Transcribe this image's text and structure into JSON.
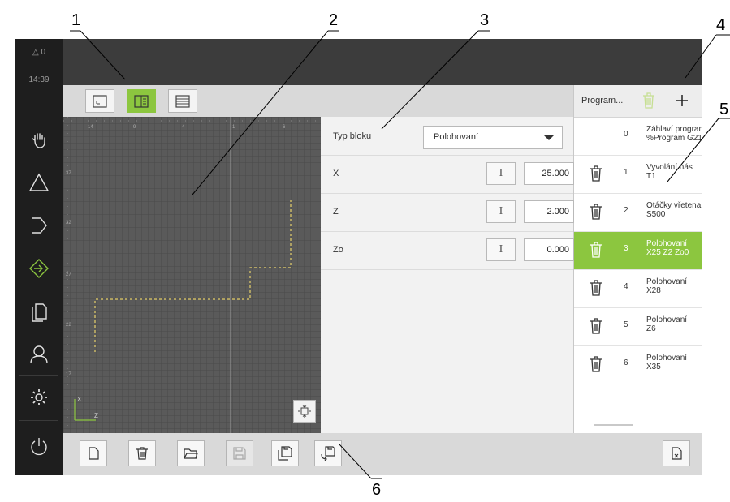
{
  "callouts": {
    "c1": "1",
    "c2": "2",
    "c3": "3",
    "c4": "4",
    "c5": "5",
    "c6": "6"
  },
  "status": {
    "alerts": "0",
    "time": "14:39"
  },
  "sidebar": {
    "items": [
      {
        "icon": "hand-icon"
      },
      {
        "icon": "triangle-icon"
      },
      {
        "icon": "arrow-right-icon"
      },
      {
        "icon": "program-run-icon"
      },
      {
        "icon": "documents-icon"
      },
      {
        "icon": "user-icon"
      },
      {
        "icon": "gear-icon"
      },
      {
        "icon": "power-icon"
      }
    ]
  },
  "toolbar": {
    "views": [
      "graphics-view",
      "split-view",
      "list-view"
    ],
    "active": "split-view"
  },
  "canvas": {
    "x_ticks": [
      "14",
      "9",
      "4",
      "1",
      "6"
    ],
    "y_ticks": [
      "37",
      "32",
      "27",
      "22",
      "17"
    ],
    "axis_x": "X",
    "axis_z": "Z"
  },
  "form": {
    "block_type_label": "Typ bloku",
    "block_type_value": "Polohovaní",
    "rows": [
      {
        "label": "X",
        "button": "I",
        "value": "25.000"
      },
      {
        "label": "Z",
        "button": "I",
        "value": "2.000"
      },
      {
        "label": "Zo",
        "button": "I",
        "value": "0.000"
      }
    ]
  },
  "program": {
    "title": "Program...",
    "header_row": {
      "num": "0",
      "line1": "Záhlaví programu Progr",
      "line2": "%Program G21"
    },
    "rows": [
      {
        "num": "1",
        "line1": "Vyvolání nás",
        "line2": "T1"
      },
      {
        "num": "2",
        "line1": "Otáčky vřetena",
        "line2": "S500"
      },
      {
        "num": "3",
        "line1": "Polohovaní",
        "line2": "X25 Z2 Zo0",
        "selected": true
      },
      {
        "num": "4",
        "line1": "Polohovaní",
        "line2": "X28"
      },
      {
        "num": "5",
        "line1": "Polohovaní",
        "line2": "Z6"
      },
      {
        "num": "6",
        "line1": "Polohovaní",
        "line2": "X35"
      }
    ]
  },
  "colors": {
    "accent": "#8cc63f",
    "sidebar": "#1e1e1e",
    "topbar": "#3c3c3c",
    "canvas": "#5a5a5a",
    "contour": "#e6d06a"
  }
}
